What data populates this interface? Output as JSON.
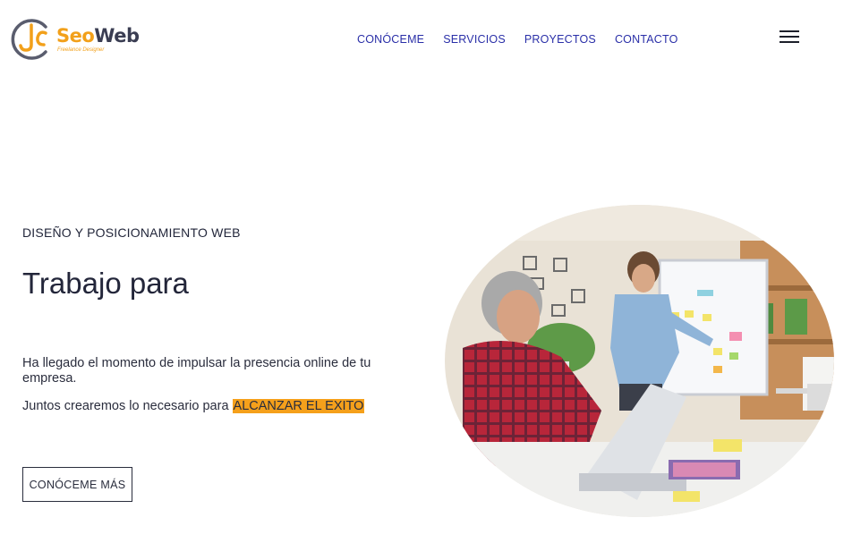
{
  "header": {
    "logo": {
      "text_seo": "Seo",
      "text_web": "Web",
      "tagline": "Freelance Designer",
      "icon": "jc-logo-icon"
    },
    "nav": [
      "CONÓCEME",
      "SERVICIOS",
      "PROYECTOS",
      "CONTACTO"
    ],
    "menu_icon": "hamburger-icon"
  },
  "hero": {
    "eyebrow": "DISEÑO Y POSICIONAMIENTO WEB",
    "title": "Trabajo para",
    "description": "Ha llegado el momento de impulsar la presencia online de tu empresa.",
    "together_prefix": "Juntos crearemos lo necesario para ",
    "together_highlight": "ALCANZAR EL EXITO",
    "cta_label": "CONÓCEME MÁS"
  },
  "colors": {
    "accent": "#f5a01b",
    "nav": "#2a2fa8",
    "text": "#23263a"
  }
}
